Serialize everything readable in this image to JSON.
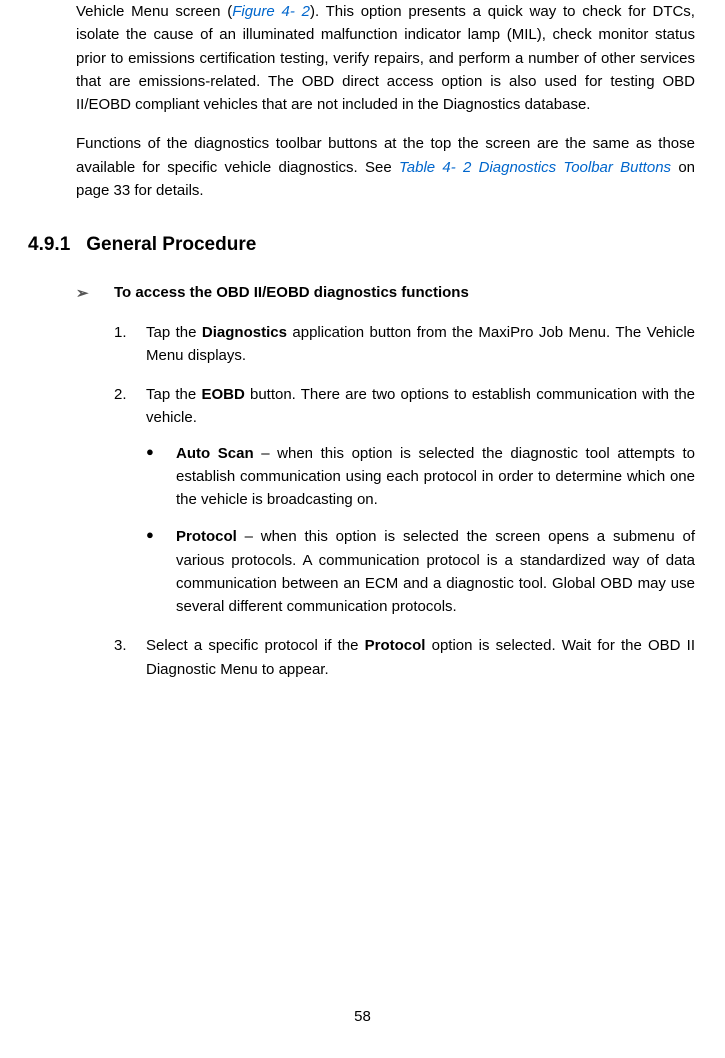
{
  "intro": {
    "p1_a": "Vehicle Menu screen (",
    "p1_ref": "Figure 4- 2",
    "p1_b": "). This option presents a quick way to check for DTCs, isolate the cause of an illuminated malfunction indicator lamp (MIL), check monitor status prior to emissions certification testing, verify repairs, and perform a number of other services that are emissions-related. The OBD direct access option is also used for testing OBD II/EOBD compliant vehicles that are not included in the Diagnostics database.",
    "p2_a": "Functions of the diagnostics toolbar buttons at the top the screen are the same as those available for specific vehicle diagnostics. See ",
    "p2_ref": "Table 4- 2 Diagnostics Toolbar Buttons",
    "p2_b": " on page 33 for details."
  },
  "section": {
    "number": "4.9.1",
    "title": "General Procedure"
  },
  "procedure": {
    "heading": "To access the OBD II/EOBD diagnostics functions",
    "steps": {
      "s1": {
        "num": "1.",
        "a": "Tap the ",
        "bold": "Diagnostics",
        "b": " application button from the MaxiPro Job Menu. The Vehicle Menu displays."
      },
      "s2": {
        "num": "2.",
        "a": "Tap the ",
        "bold": "EOBD",
        "b": " button. There are two options to establish communication with the vehicle.",
        "bullets": {
          "b1": {
            "head": "Auto Scan",
            "body": " – when this option is selected the diagnostic tool attempts to establish communication using each protocol in order to determine which one the vehicle is broadcasting on."
          },
          "b2": {
            "head": "Protocol",
            "body": " – when this option is selected the screen opens a submenu of various protocols. A communication protocol is a standardized way of data communication between an ECM and a diagnostic tool. Global OBD may use several different communication protocols."
          }
        }
      },
      "s3": {
        "num": "3.",
        "a": "Select a specific protocol if the ",
        "bold": "Protocol",
        "b": " option is selected. Wait for the OBD II Diagnostic Menu to appear."
      }
    }
  },
  "pageNumber": "58"
}
